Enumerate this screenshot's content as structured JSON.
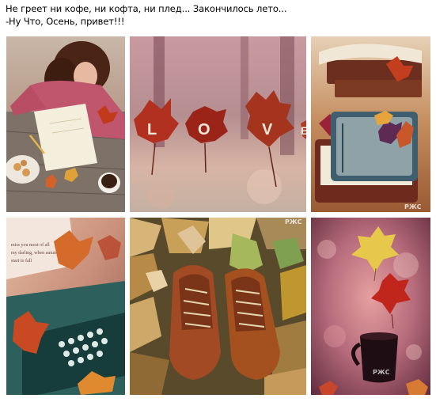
{
  "post": {
    "line1": "Не греет ни кофе, ни кофта, ни плед... Закончилось лето...",
    "line2": "-Ну Что, Осень, привет!!!"
  },
  "photos": [
    {
      "id": "photo-girl-writing",
      "watermark": ""
    },
    {
      "id": "photo-love-leaves",
      "letters": [
        "L",
        "O",
        "V",
        "E"
      ],
      "watermark": ""
    },
    {
      "id": "photo-books-leaves",
      "watermark": "РЖС"
    },
    {
      "id": "photo-typewriter",
      "paper_text": [
        "miss you most of all",
        "my darling, when autumn leaves",
        "start to fall"
      ],
      "watermark": ""
    },
    {
      "id": "photo-shoes-leaves",
      "watermark": "РЖС"
    },
    {
      "id": "photo-cup-leaves",
      "watermark": "РЖС"
    }
  ],
  "colors": {
    "autumn_red": "#a8261c",
    "autumn_orange": "#d9702a",
    "autumn_yellow": "#e6b83c"
  }
}
